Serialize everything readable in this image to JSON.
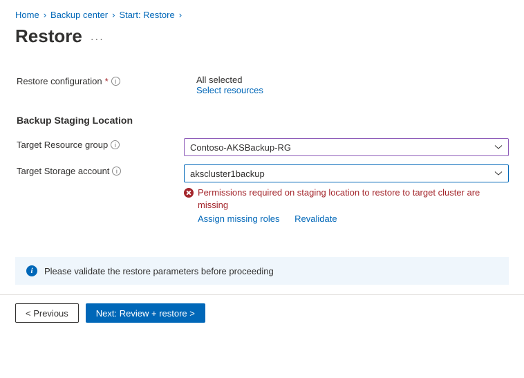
{
  "breadcrumb": {
    "home": "Home",
    "backup_center": "Backup center",
    "start_restore": "Start: Restore"
  },
  "page_title": "Restore",
  "restore_config": {
    "label": "Restore configuration",
    "value": "All selected",
    "link": "Select resources"
  },
  "section_heading": "Backup Staging Location",
  "target_rg": {
    "label": "Target Resource group",
    "value": "Contoso-AKSBackup-RG"
  },
  "target_sa": {
    "label": "Target Storage account",
    "value": "akscluster1backup",
    "error": "Permissions required on staging location to restore to target cluster are missing",
    "link_assign": "Assign missing roles",
    "link_revalidate": "Revalidate"
  },
  "banner": "Please validate the restore parameters before proceeding",
  "buttons": {
    "previous": "<  Previous",
    "next": "Next: Review + restore  >"
  }
}
